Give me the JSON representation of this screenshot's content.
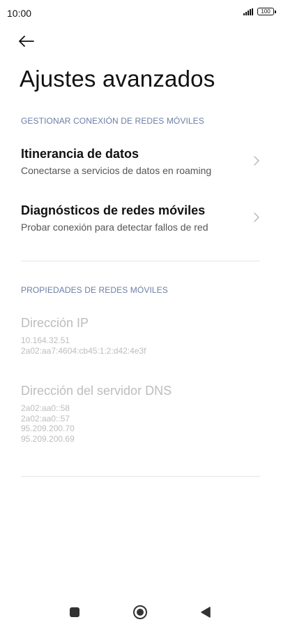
{
  "status_bar": {
    "time": "10:00",
    "battery": "100"
  },
  "header": {
    "back_icon": "arrow-left-icon",
    "title": "Ajustes avanzados"
  },
  "sections": {
    "manage": {
      "header": "GESTIONAR CONEXIÓN DE REDES MÓVILES",
      "items": [
        {
          "title": "Itinerancia de datos",
          "subtitle": "Conectarse a servicios de datos en roaming",
          "icon": "chevron-right-icon"
        },
        {
          "title": "Diagnósticos de redes móviles",
          "subtitle": "Probar conexión para detectar fallos de red",
          "icon": "chevron-right-icon"
        }
      ]
    },
    "properties": {
      "header": "PROPIEDADES DE REDES MÓVILES",
      "ip": {
        "title": "Dirección IP",
        "values": [
          "10.164.32.51",
          "2a02:aa7:4604:cb45:1:2:d42:4e3f"
        ]
      },
      "dns": {
        "title": "Dirección del servidor DNS",
        "values": [
          "2a02:aa0::58",
          "2a02:aa0::57",
          "95.209.200.70",
          "95.209.200.69"
        ]
      }
    }
  },
  "nav_bar": {
    "icons": [
      "square-recents-icon",
      "circle-home-icon",
      "triangle-back-icon"
    ]
  },
  "colors": {
    "section_header": "#6b7ea7",
    "disabled_text": "#bdbdbd",
    "divider": "#e6e6e6"
  }
}
